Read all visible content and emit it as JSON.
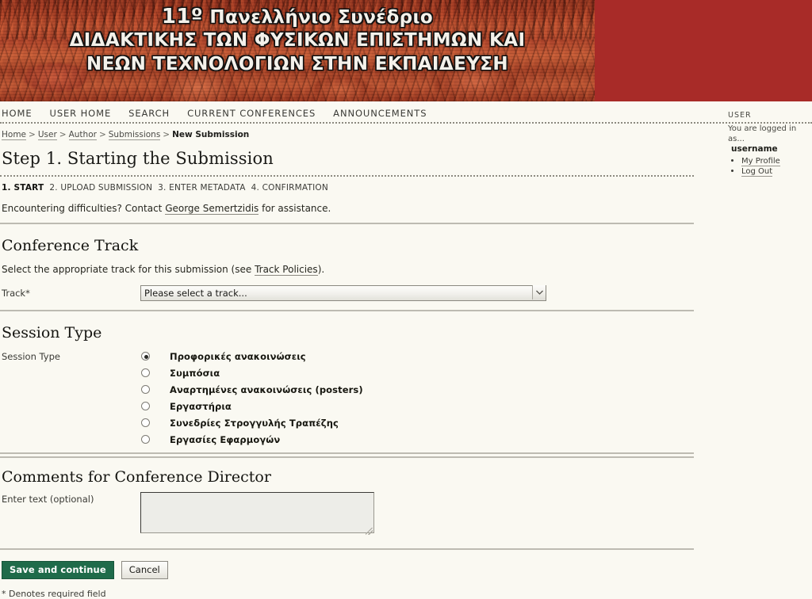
{
  "banner": {
    "line1_number": "11º",
    "line1_rest": " Πανελλήνιο Συνέδριο",
    "line2": "ΔΙΔΑΚΤΙΚΗΣ ΤΩΝ ΦΥΣΙΚΩΝ ΕΠΙΣΤΗΜΩΝ ΚΑΙ",
    "line3": "ΝΕΩΝ ΤΕΧΝΟΛΟΓΙΩΝ ΣΤΗΝ ΕΚΠΑΙΔΕΥΣΗ",
    "background_color": "#A82B28"
  },
  "nav": {
    "items": [
      {
        "label": "HOME"
      },
      {
        "label": "USER HOME"
      },
      {
        "label": "SEARCH"
      },
      {
        "label": "CURRENT CONFERENCES"
      },
      {
        "label": "ANNOUNCEMENTS"
      }
    ]
  },
  "breadcrumb": {
    "items": [
      {
        "label": "Home"
      },
      {
        "label": "User"
      },
      {
        "label": "Author"
      },
      {
        "label": "Submissions"
      },
      {
        "label": "New Submission"
      }
    ],
    "separator": ">"
  },
  "page": {
    "title": "Step 1. Starting the Submission"
  },
  "steps": {
    "items": [
      {
        "label": "1. START",
        "active": true
      },
      {
        "label": "2. UPLOAD SUBMISSION",
        "active": false
      },
      {
        "label": "3. ENTER METADATA",
        "active": false
      },
      {
        "label": "4. CONFIRMATION",
        "active": false
      }
    ]
  },
  "difficulties": {
    "prefix": "Encountering difficulties? Contact ",
    "link": "George Semertzidis",
    "suffix": " for assistance."
  },
  "conference_track": {
    "heading": "Conference Track",
    "helper_prefix": "Select the appropriate track for this submission (see ",
    "helper_link": "Track Policies",
    "helper_suffix": ").",
    "field_label": "Track*",
    "selected_option": "Please select a track...",
    "options": [
      "Please select a track..."
    ]
  },
  "session_type": {
    "heading": "Session Type",
    "field_label": "Session Type",
    "options": [
      {
        "label": "Προφορικές ανακοινώσεις",
        "checked": true
      },
      {
        "label": "Συμπόσια",
        "checked": false
      },
      {
        "label": "Αναρτημένες ανακοινώσεις (posters)",
        "checked": false
      },
      {
        "label": "Εργαστήρια",
        "checked": false
      },
      {
        "label": "Συνεδρίες Στρογγυλής Τραπέζης",
        "checked": false
      },
      {
        "label": "Εργασίες Εφαρμογών",
        "checked": false
      }
    ]
  },
  "comments": {
    "heading": "Comments for Conference Director",
    "field_label": "Enter text (optional)",
    "value": "",
    "placeholder": ""
  },
  "actions": {
    "save_label": "Save and continue",
    "cancel_label": "Cancel",
    "save_color": "#1F6B4A",
    "required_note": "* Denotes required field"
  },
  "sidebar": {
    "title": "USER",
    "logged_in_text": "You are logged in as...",
    "username": "username",
    "links": [
      {
        "label": "My Profile"
      },
      {
        "label": "Log Out"
      }
    ]
  }
}
